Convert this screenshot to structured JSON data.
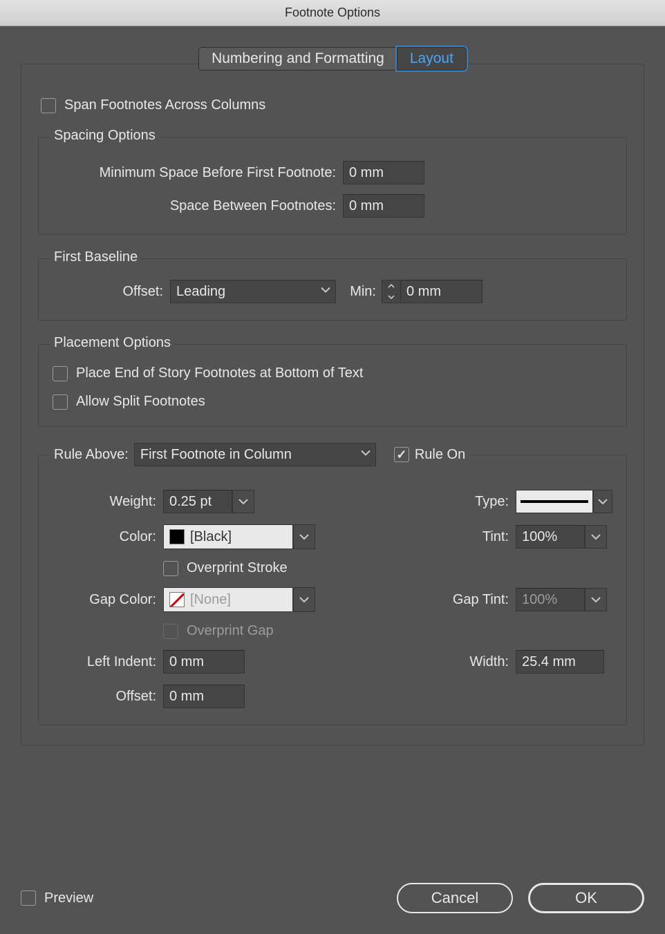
{
  "title": "Footnote Options",
  "tabs": {
    "numbering": "Numbering and Formatting",
    "layout": "Layout"
  },
  "span_columns": {
    "label": "Span Footnotes Across Columns",
    "checked": false
  },
  "spacing": {
    "legend": "Spacing Options",
    "min_before_label": "Minimum Space Before First Footnote:",
    "min_before_value": "0 mm",
    "between_label": "Space Between Footnotes:",
    "between_value": "0 mm"
  },
  "baseline": {
    "legend": "First Baseline",
    "offset_label": "Offset:",
    "offset_value": "Leading",
    "min_label": "Min:",
    "min_value": "0 mm"
  },
  "placement": {
    "legend": "Placement Options",
    "end_of_story": {
      "label": "Place End of Story Footnotes at Bottom of Text",
      "checked": false
    },
    "split": {
      "label": "Allow Split Footnotes",
      "checked": false
    }
  },
  "rule": {
    "above_label": "Rule Above:",
    "above_value": "First Footnote in Column",
    "rule_on": {
      "label": "Rule On",
      "checked": true
    },
    "weight_label": "Weight:",
    "weight_value": "0.25 pt",
    "type_label": "Type:",
    "color_label": "Color:",
    "color_value": "[Black]",
    "tint_label": "Tint:",
    "tint_value": "100%",
    "overprint_stroke": {
      "label": "Overprint Stroke",
      "checked": false
    },
    "gap_color_label": "Gap Color:",
    "gap_color_value": "[None]",
    "gap_tint_label": "Gap Tint:",
    "gap_tint_value": "100%",
    "overprint_gap": {
      "label": "Overprint Gap",
      "checked": false,
      "disabled": true
    },
    "left_indent_label": "Left Indent:",
    "left_indent_value": "0 mm",
    "width_label": "Width:",
    "width_value": "25.4 mm",
    "offset_label": "Offset:",
    "offset_value": "0 mm"
  },
  "footer": {
    "preview": "Preview",
    "cancel": "Cancel",
    "ok": "OK"
  }
}
